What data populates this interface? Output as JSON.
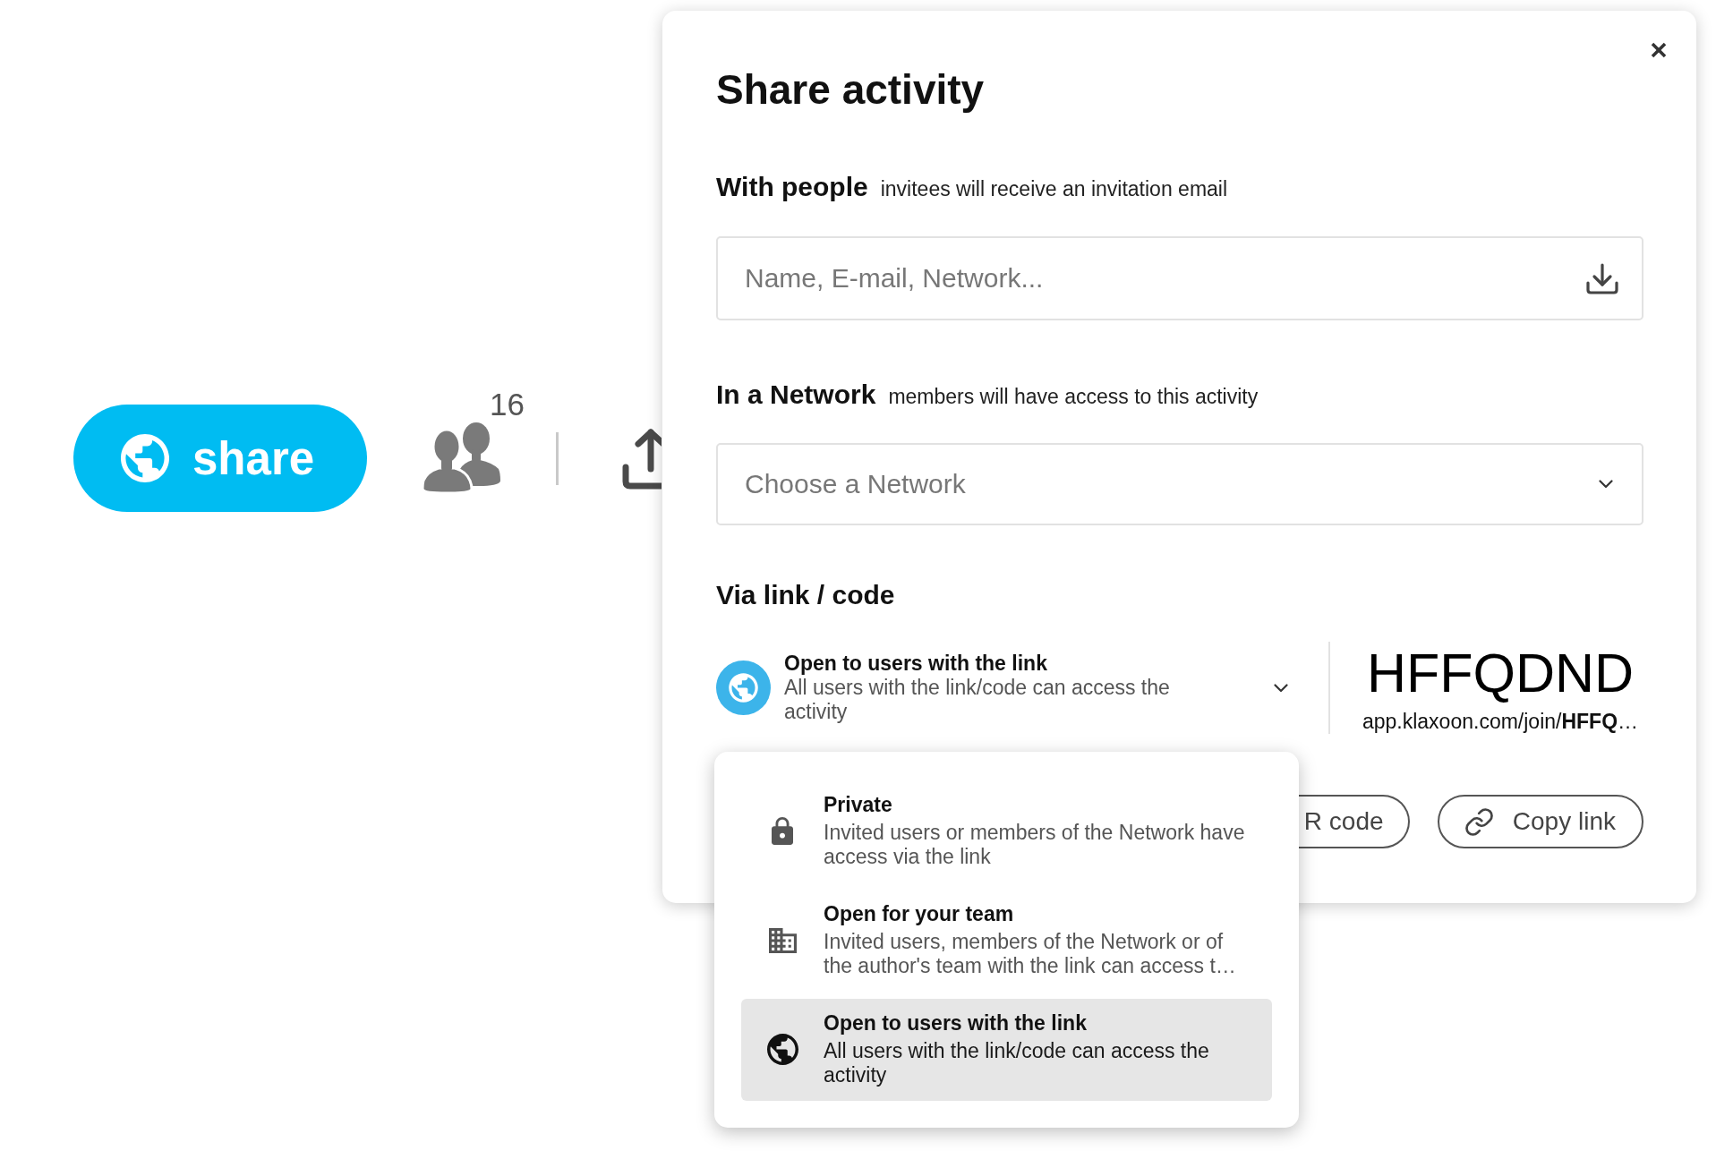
{
  "toolbar": {
    "share_button": {
      "label": "share"
    },
    "participants": {
      "count": "16"
    }
  },
  "dialog": {
    "title": "Share activity",
    "with_people": {
      "heading": "With people",
      "hint": "invitees will receive an invitation email",
      "input": {
        "placeholder": "Name, E-mail, Network..."
      }
    },
    "in_a_network": {
      "heading": "In a Network",
      "hint": "members will have access to this activity",
      "select": {
        "placeholder": "Choose a Network"
      }
    },
    "via_link": {
      "heading": "Via link / code",
      "access": {
        "title": "Open to users with the link",
        "description": "All users with the link/code can access the activity",
        "expanded": true,
        "options": [
          {
            "kind": "lock",
            "title": "Private",
            "description": "Invited users or members of the Network have access via the link",
            "selected": false
          },
          {
            "kind": "building",
            "title": "Open for your team",
            "description": "Invited users, members of the Network or of the author's team with the link can access t…",
            "selected": false
          },
          {
            "kind": "globe",
            "title": "Open to users with the link",
            "description": "All users with the link/code can access the activity",
            "selected": true
          }
        ]
      },
      "code": "HFFQDND",
      "link": "app.klaxoon.com/join/**HFFQ**…",
      "buttons": [
        {
          "kind": "qr",
          "label": "R code"
        },
        {
          "kind": "copy",
          "label": "Copy link"
        }
      ]
    }
  }
}
